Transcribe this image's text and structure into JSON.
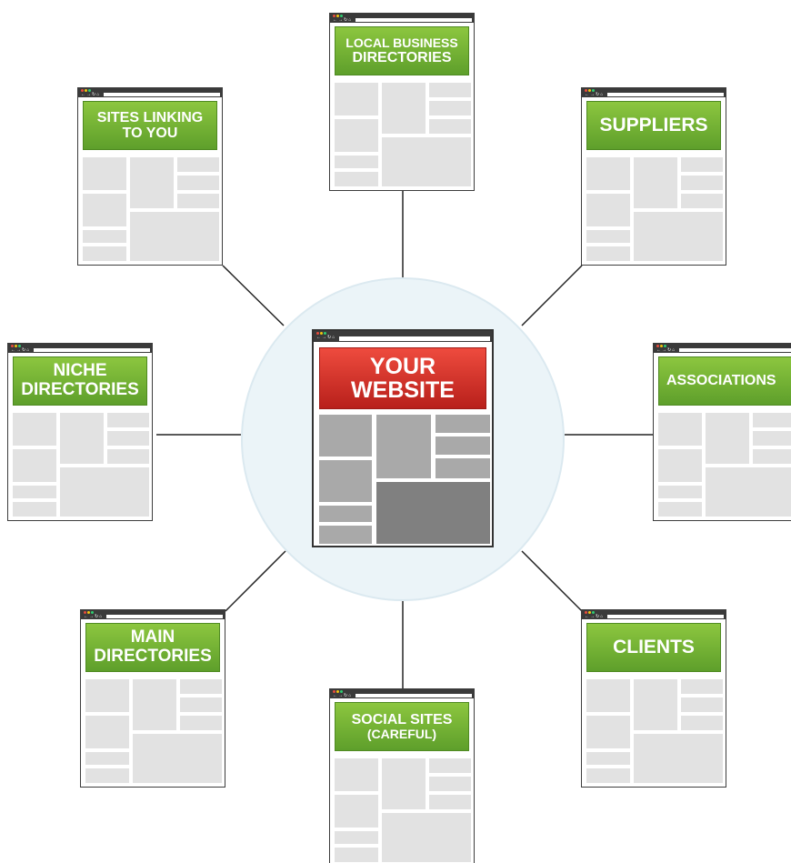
{
  "hub": {
    "label_line1": "YOUR",
    "label_line2": "WEBSITE",
    "banner_color": "#d9302a"
  },
  "nodes": [
    {
      "id": "local-business-directories",
      "line1": "LOCAL BUSINESS",
      "line2": "DIRECTORIES"
    },
    {
      "id": "sites-linking-to-you",
      "line1": "SITES LINKING",
      "line2": "TO YOU"
    },
    {
      "id": "suppliers",
      "line1": "SUPPLIERS",
      "line2": ""
    },
    {
      "id": "niche-directories",
      "line1": "NICHE",
      "line2": "DIRECTORIES"
    },
    {
      "id": "associations",
      "line1": "ASSOCIATIONS",
      "line2": ""
    },
    {
      "id": "main-directories",
      "line1": "MAIN",
      "line2": "DIRECTORIES"
    },
    {
      "id": "clients",
      "line1": "CLIENTS",
      "line2": ""
    },
    {
      "id": "social-sites",
      "line1": "SOCIAL SITES",
      "line2": "(CAREFUL)"
    }
  ],
  "colors": {
    "node_banner": "#76b53a",
    "hub_circle": "#ebf4f8",
    "connector": "#222222"
  }
}
